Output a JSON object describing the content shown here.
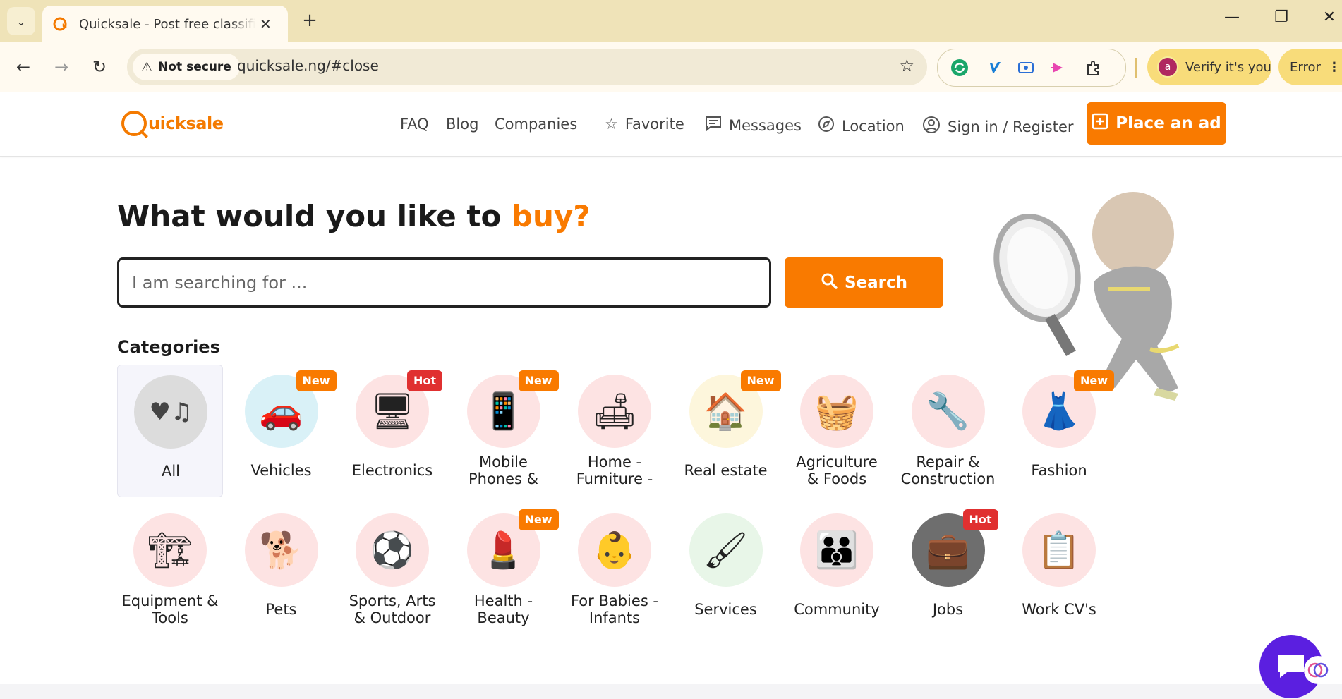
{
  "browser": {
    "tab_title": "Quicksale - Post free classified ads",
    "url": "quicksale.ng/#close",
    "security_label": "Not secure",
    "profile_label": "Verify it's you",
    "profile_initial": "a",
    "error_label": "Error"
  },
  "site": {
    "logo_text": "uicksale",
    "nav": {
      "faq": "FAQ",
      "blog": "Blog",
      "companies": "Companies",
      "favorite": "Favorite",
      "messages": "Messages",
      "location": "Location",
      "sign_in": "Sign in / Register",
      "place_ad": "Place an ad"
    },
    "accent_color": "#f97a00"
  },
  "hero": {
    "title_prefix": "What would you like to ",
    "title_highlight": "buy?"
  },
  "search": {
    "placeholder": "I am searching for ...",
    "button_label": "Search"
  },
  "categories": {
    "heading": "Categories",
    "items": [
      {
        "label": "All",
        "badge": "",
        "icon": "all-categories-icon"
      },
      {
        "label": "Vehicles",
        "badge": "New",
        "icon": "car-icon"
      },
      {
        "label": "Electronics",
        "badge": "Hot",
        "icon": "electronics-icon"
      },
      {
        "label": "Mobile\nPhones &",
        "badge": "New",
        "icon": "phone-icon"
      },
      {
        "label": "Home -\nFurniture -",
        "badge": "",
        "icon": "armchair-icon"
      },
      {
        "label": "Real estate",
        "badge": "New",
        "icon": "house-icon"
      },
      {
        "label": "Agriculture\n& Foods",
        "badge": "",
        "icon": "food-basket-icon"
      },
      {
        "label": "Repair &\nConstruction",
        "badge": "",
        "icon": "tools-icon"
      },
      {
        "label": "Fashion",
        "badge": "New",
        "icon": "dress-icon"
      },
      {
        "label": "Equipment &\nTools",
        "badge": "",
        "icon": "equipment-icon"
      },
      {
        "label": "Pets",
        "badge": "",
        "icon": "pets-icon"
      },
      {
        "label": "Sports, Arts\n& Outdoor",
        "badge": "",
        "icon": "sports-balls-icon"
      },
      {
        "label": "Health -\nBeauty",
        "badge": "New",
        "icon": "cosmetics-icon"
      },
      {
        "label": "For Babies -\nInfants",
        "badge": "",
        "icon": "baby-icon"
      },
      {
        "label": "Services",
        "badge": "",
        "icon": "paint-roller-icon"
      },
      {
        "label": "Community",
        "badge": "",
        "icon": "people-icon"
      },
      {
        "label": "Jobs",
        "badge": "Hot",
        "icon": "briefcase-icon"
      },
      {
        "label": "Work CV's",
        "badge": "",
        "icon": "resume-icon"
      }
    ]
  }
}
